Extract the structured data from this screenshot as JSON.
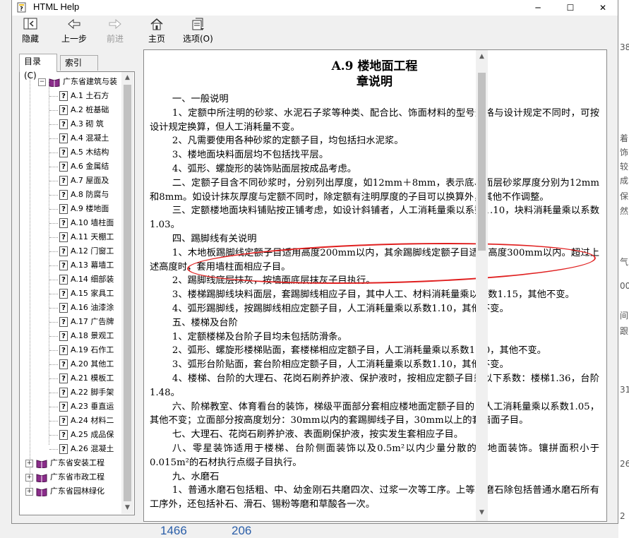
{
  "window": {
    "title": "HTML Help",
    "controls": {
      "minimize": "─",
      "maximize": "☐",
      "close": "✕"
    }
  },
  "toolbar": {
    "hide": "隐藏",
    "back": "上一步",
    "forward": "前进",
    "home": "主页",
    "options": "选项(O)"
  },
  "tabs": {
    "contents": "目录(C)",
    "index": "索引(N)"
  },
  "tree": {
    "root": "广东省建筑与装",
    "items": [
      "A.1  土石方",
      "A.2  桩基础",
      "A.3  砌  筑",
      "A.4  混凝土",
      "A.5  木结构",
      "A.6  金属结",
      "A.7  屋面及",
      "A.8  防腐与",
      "A.9  楼地面",
      "A.10  墙柱面",
      "A.11  天棚工",
      "A.12  门窗工",
      "A.13  幕墙工",
      "A.14  细部装",
      "A.15  家具工",
      "A.16  油漆涂",
      "A.17  广告牌",
      "A.18  景观工",
      "A.19  石作工",
      "A.20  其他工",
      "A.21  模板工",
      "A.22  脚手架",
      "A.23  垂直运",
      "A.24  材料二",
      "A.25  成品保",
      "A.26  混凝土"
    ],
    "books": [
      "广东省安装工程",
      "广东省市政工程",
      "广东省园林绿化"
    ]
  },
  "document": {
    "title": "A.9   楼地面工程",
    "subtitle": "章说明",
    "paragraphs": [
      "一、一般说明",
      "1、定额中所注明的砂浆、水泥石子浆等种类、配合比、饰面材料的型号规格与设计规定不同时，可按设计规定换算，但人工消耗量不变。",
      "2、凡需要使用各种砂浆的定额子目，均包括扫水泥浆。",
      "3、楼地面块料面层均不包括找平层。",
      "4、弧形、螺旋形的装饰贴面层按成品考虑。",
      "二、定额子目含不同砂浆时，分别列出厚度，如12mm＋8mm，表示底、面层砂浆厚度分别为12mm和8mm。如设计抹灰厚度与定额不同时，除定额有注明厚度的子目可以换算外，其他不作调整。",
      "三、定额楼地面块料铺贴按正铺考虑，如设计斜铺者，人工消耗量乘以系数1.10，块料消耗量乘以系数1.03。",
      "四、踢脚线有关说明",
      "1、木地板踢脚线定额子目适用高度200mm以内，其余踢脚线定额子目适用高度300mm以内。超过上述高度时，套用墙柱面相应子目。",
      "2、踢脚线底层抹灰，按墙面底层抹灰子目执行。",
      "3、楼梯踢脚线块料面层，套踢脚线相应子目，其中人工、材料消耗量乘以系数1.15，其他不变。",
      "4、弧形踢脚线，按踢脚线相应定额子目，人工消耗量乘以系数1.10，其他不变。",
      "五、楼梯及台阶",
      "1、定额楼梯及台阶子目均未包括防滑条。",
      "2、弧形、螺旋形楼梯贴面，套楼梯相应定额子目，人工消耗量乘以系数1.10，其他不变。",
      "3、弧形台阶贴面，套台阶相应定额子目，人工消耗量乘以系数1.10，其他不变。",
      "4、楼梯、台阶的大理石、花岗石刷养护液、保护液时，按相应定额子目乘以下系数：楼梯1.36，台阶1.48。",
      "六、阶梯教室、体育看台的装饰，梯级平面部分套相应楼地面定额子目的，人工消耗量乘以系数1.05，其他不变；立面部分按高度划分：30mm以内的套踢脚线子目，30mm以上的套墙面子目。",
      "七、大理石、花岗石刷养护液、表面刷保护液，按实发生套相应子目。",
      "八、零星装饰适用于楼梯、台阶侧面装饰以及0.5m²以内少量分散的楼地面装饰。镶拼面积小于0.015m²的石材执行点缀子目执行。",
      "九、水磨石",
      "1、普通水磨石包括粗、中、幼金刚石共磨四次、过浆一次等工序。上等水磨石除包括普通水磨石所有工序外，还包括补石、滑石、锡粉等磨和草酸各一次。"
    ]
  },
  "background": {
    "right_fragments": [
      "38",
      "着",
      "饰",
      "较",
      "成",
      "保",
      "然",
      "气",
      "00",
      "间",
      "跟",
      "31",
      "26",
      "2"
    ],
    "bottom_numbers": [
      "1466",
      "206"
    ]
  },
  "colors": {
    "highlight_oval": "#e02020",
    "background_link": "#2a5ea8"
  }
}
